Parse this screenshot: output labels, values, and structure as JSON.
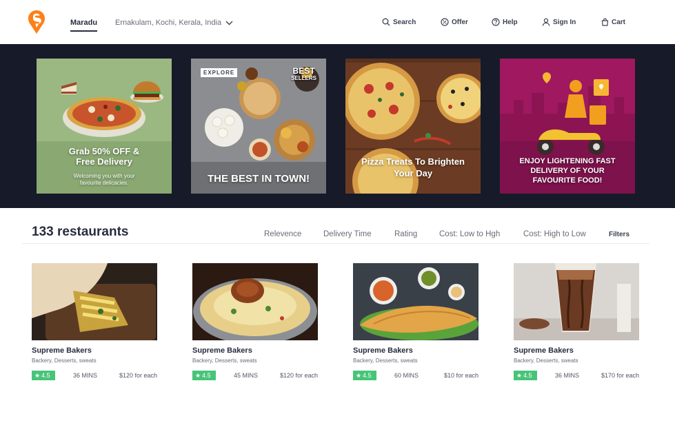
{
  "header": {
    "location_primary": "Maradu",
    "location_secondary": "Ernakulam, Kochi, Kerala, India",
    "nav": {
      "search": "Search",
      "offer": "Offer",
      "help": "Help",
      "sign_in": "Sign In",
      "cart": "Cart"
    },
    "brand_color": "#fc8019"
  },
  "banners": [
    {
      "line1": "Grab 50% OFF &",
      "line2": "Free Delivery",
      "line3": "Welcoming you with your",
      "line4": "favourite delicacies."
    },
    {
      "tag": "EXPLORE",
      "badge_top": "BEST",
      "badge_bottom": "SELLERS",
      "line1": "THE BEST IN TOWN!"
    },
    {
      "line1": "Pizza Treats To Brighten",
      "line2": "Your Day"
    },
    {
      "line1": "ENJOY LIGHTENING FAST",
      "line2": "DELIVERY OF YOUR",
      "line3": "FAVOURITE FOOD!"
    }
  ],
  "listing": {
    "count_label": "133 restaurants",
    "sort_options": [
      "Relevence",
      "Delivery Time",
      "Rating",
      "Cost: Low to Hgh",
      "Cost: High to Low"
    ],
    "filters_label": "Filters"
  },
  "restaurants": [
    {
      "name": "Supreme Bakers",
      "cuisine": "Backery, Desserts, sweats",
      "rating": "4.5",
      "time": "36 MINS",
      "cost": "$120 for each"
    },
    {
      "name": "Supreme Bakers",
      "cuisine": "Backery, Desserts, sweats",
      "rating": "4.5",
      "time": "45 MINS",
      "cost": "$120 for each"
    },
    {
      "name": "Supreme Bakers",
      "cuisine": "Backery, Desserts, sweats",
      "rating": "4.5",
      "time": "60 MINS",
      "cost": "$10 for each"
    },
    {
      "name": "Supreme Bakers",
      "cuisine": "Backery, Desserts, sweats",
      "rating": "4.5",
      "time": "36 MINS",
      "cost": "$170 for each"
    }
  ],
  "icons": {
    "logo": "swiggy-logo-icon",
    "location_dropdown": "chevron-down-icon",
    "search": "search-icon",
    "offer": "offer-badge-icon",
    "help": "help-circle-icon",
    "sign_in": "user-icon",
    "cart": "bag-icon",
    "rating": "star-icon"
  },
  "colors": {
    "rating_green": "#48c479",
    "banner_bg": "#171a29"
  }
}
